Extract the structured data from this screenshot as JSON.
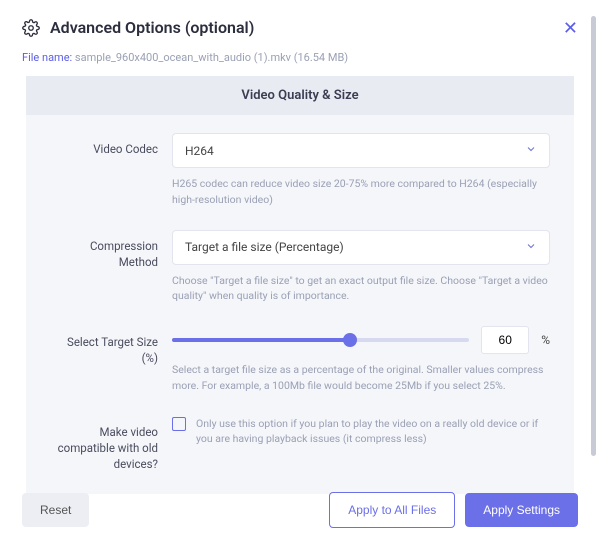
{
  "header": {
    "title": "Advanced Options (optional)"
  },
  "file": {
    "label": "File name: ",
    "name": "sample_960x400_ocean_with_audio (1).mkv (16.54 MB)"
  },
  "panel": {
    "title": "Video Quality & Size",
    "codec": {
      "label": "Video Codec",
      "value": "H264",
      "hint": "H265 codec can reduce video size 20-75% more compared to H264 (especially high-resolution video)"
    },
    "compression": {
      "label": "Compression Method",
      "value": "Target a file size (Percentage)",
      "hint": "Choose \"Target a file size\" to get an exact output file size. Choose \"Target a video quality\" when quality is of importance."
    },
    "target": {
      "label": "Select Target Size (%)",
      "value": "60",
      "symbol": "%",
      "hint": "Select a target file size as a percentage of the original. Smaller values compress more. For example, a 100Mb file would become 25Mb if you select 25%."
    },
    "compat": {
      "label": "Make video compatible with old devices?",
      "hint": "Only use this option if you plan to play the video on a really old device or if you are having playback issues (it compress less)"
    }
  },
  "footer": {
    "reset": "Reset",
    "apply_all": "Apply to All Files",
    "apply": "Apply Settings"
  }
}
